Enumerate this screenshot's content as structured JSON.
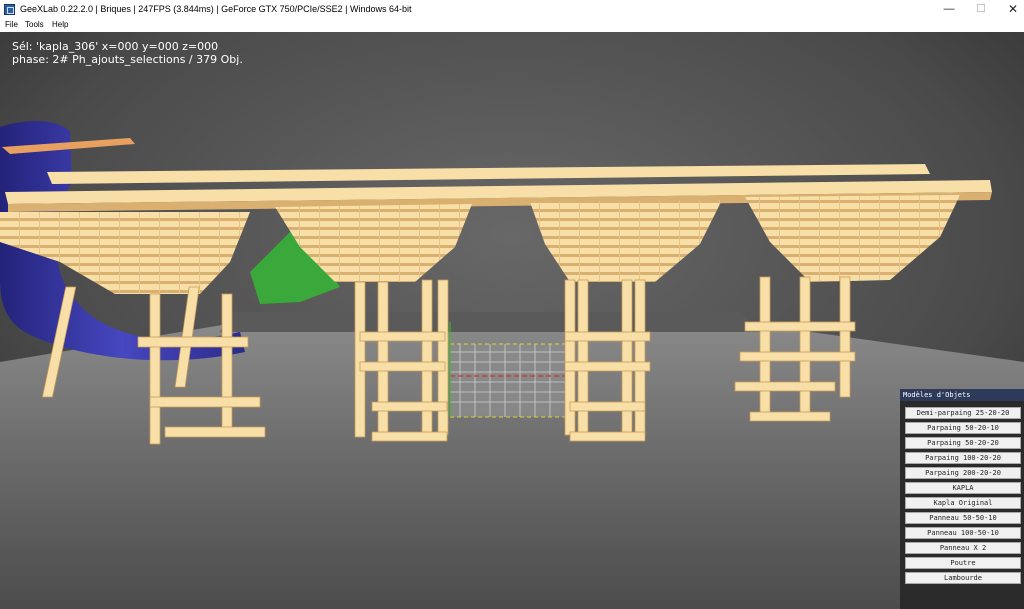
{
  "window": {
    "title": "GeeXLab 0.22.2.0 | Briques | 247FPS (3.844ms) | GeForce GTX 750/PCIe/SSE2 | Windows 64-bit",
    "minimize": "—",
    "maximize": "☐",
    "close": "✕"
  },
  "menu": [
    "File",
    "Tools",
    "Help"
  ],
  "hud": {
    "line1": "Sél:  'kapla_306' x=000 y=000 z=000",
    "line2": "phase:  2# Ph_ajouts_selections / 379 Obj."
  },
  "panel": {
    "title": "Modèles d'Objets",
    "buttons": [
      "Demi-parpaing 25-20-20",
      "Parpaing 50-20-10",
      "Parpaing 50-20-20",
      "Parpaing 100-20-20",
      "Parpaing 200-20-20",
      "KAPLA",
      "Kapla Original",
      "Panneau 50-50-10",
      "Panneau 100-50-10",
      "Panneau X 2",
      "Poutre",
      "Lambourde"
    ]
  },
  "colors": {
    "wood_light": "#f8dfa8",
    "wood_shadow": "#d9b070",
    "blue_object": "#3a3aa8",
    "green_object": "#3aa83a",
    "floor": "#707070"
  }
}
